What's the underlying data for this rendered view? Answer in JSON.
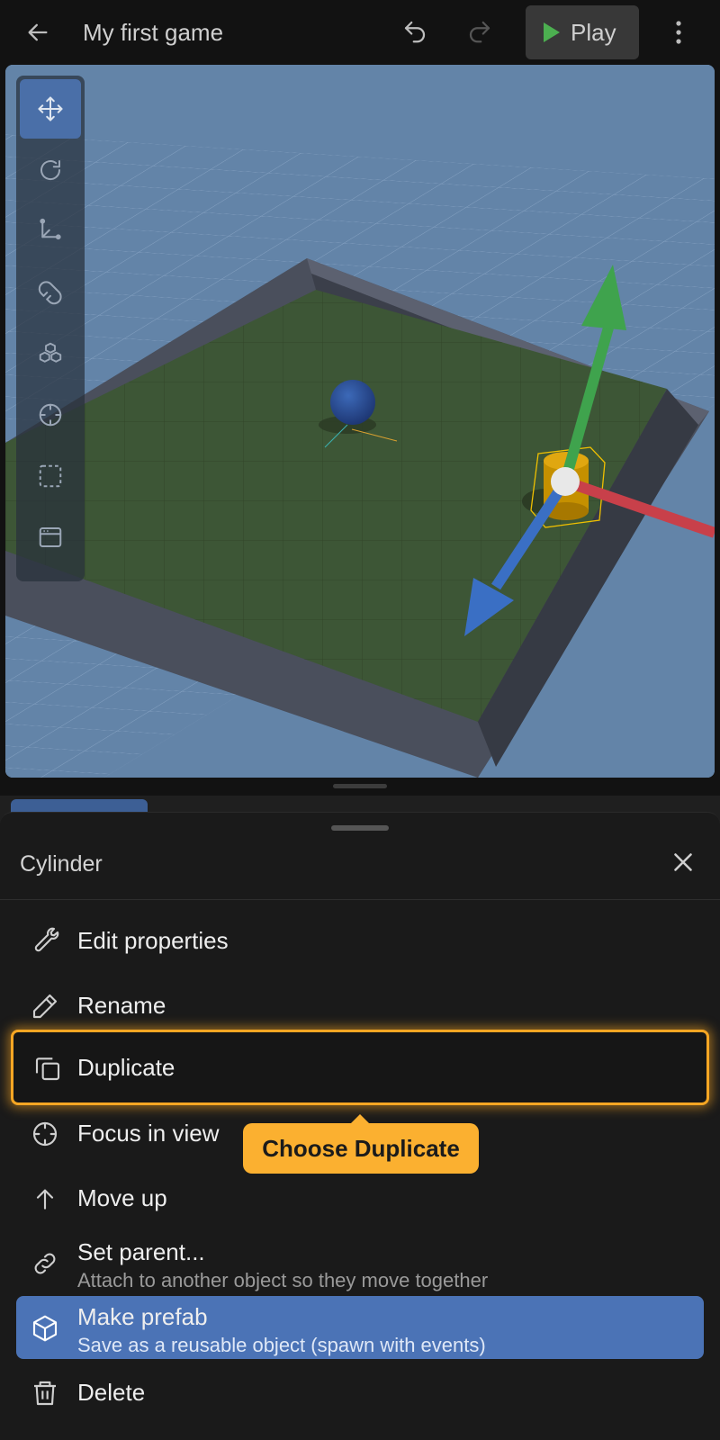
{
  "header": {
    "title": "My first game",
    "play_label": "Play",
    "back_icon": "arrow-left-icon",
    "undo_icon": "undo-icon",
    "redo_icon": "redo-icon",
    "menu_icon": "more-vertical-icon"
  },
  "toolbar": {
    "tools": [
      {
        "icon": "move-icon",
        "active": true
      },
      {
        "icon": "rotate-icon",
        "active": false
      },
      {
        "icon": "scale-axes-icon",
        "active": false
      },
      {
        "icon": "magnet-icon",
        "active": false
      },
      {
        "icon": "cubes-icon",
        "active": false
      },
      {
        "icon": "crosshair-icon",
        "active": false
      },
      {
        "icon": "selection-box-icon",
        "active": false
      },
      {
        "icon": "window-icon",
        "active": false
      }
    ]
  },
  "sheet": {
    "title": "Cylinder",
    "items": [
      {
        "label": "Edit properties",
        "icon": "wrench-icon"
      },
      {
        "label": "Rename",
        "icon": "pencil-icon"
      },
      {
        "label": "Duplicate",
        "icon": "copy-icon"
      },
      {
        "label": "Focus in view",
        "icon": "crosshair-icon"
      },
      {
        "label": "Move up",
        "icon": "arrow-up-icon"
      },
      {
        "label": "Set parent...",
        "sublabel": "Attach to another object so they move together",
        "icon": "link-icon"
      },
      {
        "label": "Make prefab",
        "sublabel": "Save as a reusable object (spawn with events)",
        "icon": "box-icon"
      },
      {
        "label": "Delete",
        "icon": "trash-icon"
      }
    ]
  },
  "tooltip": {
    "text": "Choose Duplicate"
  },
  "colors": {
    "accent_highlight": "#f5a623",
    "selected_item": "#4b73b6",
    "play_icon": "#4caf50",
    "gizmo_y": "#3fa34d",
    "gizmo_x": "#c8404a",
    "gizmo_z": "#3a6fc4"
  }
}
